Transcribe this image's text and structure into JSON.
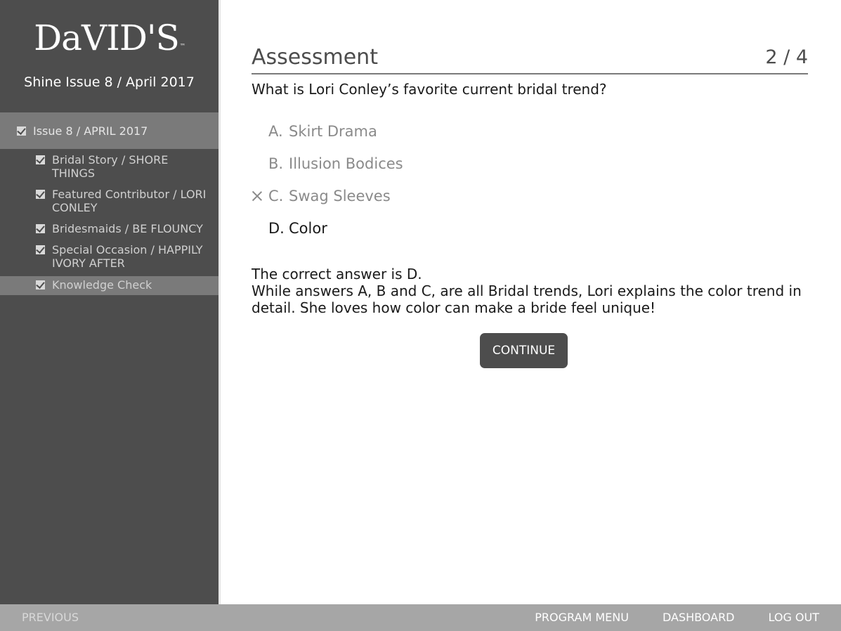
{
  "sidebar": {
    "logo": "DaVID'S",
    "logo_tm": "™",
    "course_title": "Shine Issue 8 / April 2017",
    "issue_label": "Issue 8 / APRIL 2017",
    "items": [
      {
        "label": "Bridal Story / SHORE THINGS"
      },
      {
        "label": "Featured Contributor / LORI CONLEY"
      },
      {
        "label": "Bridesmaids / BE FLOUNCY"
      },
      {
        "label": "Special Occasion / HAPPILY IVORY AFTER"
      },
      {
        "label": "Knowledge Check"
      }
    ]
  },
  "assessment": {
    "title": "Assessment",
    "progress": "2 / 4",
    "question": "What is Lori Conley’s favorite current bridal trend?",
    "options": [
      {
        "letter": "A.",
        "text": "Skirt Drama"
      },
      {
        "letter": "B.",
        "text": "Illusion Bodices"
      },
      {
        "letter": "C.",
        "text": "Swag Sleeves"
      },
      {
        "letter": "D.",
        "text": "Color"
      }
    ],
    "feedback_line1": "The correct answer is D.",
    "feedback_line2": "While answers A, B and C, are all Bridal trends, Lori explains the color trend in detail. She loves how color can make a bride feel unique!",
    "continue_label": "CONTINUE"
  },
  "footer": {
    "previous": "PREVIOUS",
    "program_menu": "PROGRAM MENU",
    "dashboard": "DASHBOARD",
    "logout": "LOG OUT"
  },
  "colors": {
    "sidebar_bg": "#4d4d4d",
    "highlight_bg": "#7a7a7a",
    "footer_bg": "#a6a6a6",
    "button_bg": "#4d4d4d"
  }
}
